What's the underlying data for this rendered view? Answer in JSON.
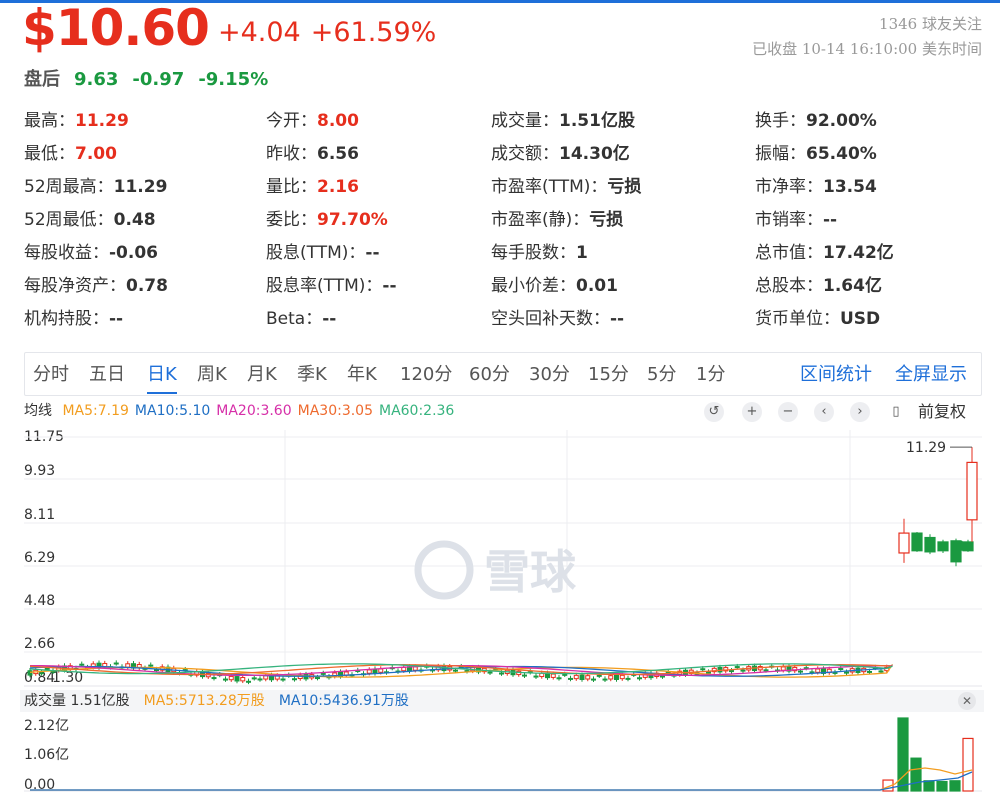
{
  "quote": {
    "price": "$10.60",
    "change": "+4.04",
    "change_pct": "+61.59%",
    "followers": "1346 球友关注",
    "market_status": "已收盘 10-14 16:10:00 美东时间"
  },
  "after_hours": {
    "label": "盘后",
    "price": "9.63",
    "change": "-0.97",
    "change_pct": "-9.15%"
  },
  "stats": [
    {
      "k": "最高：",
      "v": "11.29",
      "red": true
    },
    {
      "k": "今开：",
      "v": "8.00",
      "red": true
    },
    {
      "k": "成交量：",
      "v": "1.51亿股",
      "red": false
    },
    {
      "k": "换手：",
      "v": "92.00%",
      "red": false
    },
    {
      "k": "最低：",
      "v": "7.00",
      "red": true
    },
    {
      "k": "昨收：",
      "v": "6.56",
      "red": false
    },
    {
      "k": "成交额：",
      "v": "14.30亿",
      "red": false
    },
    {
      "k": "振幅：",
      "v": "65.40%",
      "red": false
    },
    {
      "k": "52周最高：",
      "v": "11.29",
      "red": false
    },
    {
      "k": "量比：",
      "v": "2.16",
      "red": true
    },
    {
      "k": "市盈率(TTM)：",
      "v": "亏损",
      "red": false
    },
    {
      "k": "市净率：",
      "v": "13.54",
      "red": false
    },
    {
      "k": "52周最低：",
      "v": "0.48",
      "red": false
    },
    {
      "k": "委比：",
      "v": "97.70%",
      "red": true
    },
    {
      "k": "市盈率(静)：",
      "v": "亏损",
      "red": false
    },
    {
      "k": "市销率：",
      "v": "--",
      "red": false
    },
    {
      "k": "每股收益：",
      "v": "-0.06",
      "red": false
    },
    {
      "k": "股息(TTM)：",
      "v": "--",
      "red": false
    },
    {
      "k": "每手股数：",
      "v": "1",
      "red": false
    },
    {
      "k": "总市值：",
      "v": "17.42亿",
      "red": false
    },
    {
      "k": "每股净资产：",
      "v": "0.78",
      "red": false
    },
    {
      "k": "股息率(TTM)：",
      "v": "--",
      "red": false
    },
    {
      "k": "最小价差：",
      "v": "0.01",
      "red": false
    },
    {
      "k": "总股本：",
      "v": "1.64亿",
      "red": false
    },
    {
      "k": "机构持股：",
      "v": "--",
      "red": false
    },
    {
      "k": "Beta：",
      "v": "--",
      "red": false
    },
    {
      "k": "空头回补天数：",
      "v": "--",
      "red": false
    },
    {
      "k": "货币单位：",
      "v": "USD",
      "red": false
    }
  ],
  "tabs": [
    {
      "label": "分时",
      "active": false
    },
    {
      "label": "五日",
      "active": false
    },
    {
      "label": "日K",
      "active": true
    },
    {
      "label": "周K",
      "active": false
    },
    {
      "label": "月K",
      "active": false
    },
    {
      "label": "季K",
      "active": false
    },
    {
      "label": "年K",
      "active": false
    },
    {
      "label": "120分",
      "active": false
    },
    {
      "label": "60分",
      "active": false
    },
    {
      "label": "30分",
      "active": false
    },
    {
      "label": "15分",
      "active": false
    },
    {
      "label": "5分",
      "active": false
    },
    {
      "label": "1分",
      "active": false
    }
  ],
  "tab_actions": {
    "range_stats": "区间统计",
    "fullscreen": "全屏显示"
  },
  "ma_legend": {
    "title": "均线",
    "items": [
      {
        "label": "MA5:7.19",
        "color": "#f29d1f"
      },
      {
        "label": "MA10:5.10",
        "color": "#1f6fc4"
      },
      {
        "label": "MA20:3.60",
        "color": "#d62fa8"
      },
      {
        "label": "MA30:3.05",
        "color": "#ee6a2e"
      },
      {
        "label": "MA60:2.36",
        "color": "#36b37e"
      }
    ]
  },
  "toolbar": {
    "undo": "↺",
    "zoom_in": "+",
    "zoom_out": "−",
    "prev": "‹",
    "next": "›",
    "settings": "▯",
    "adjust_label": "前复权"
  },
  "watermark": "雪球",
  "chart_data": {
    "type": "candlestick",
    "price_axis": {
      "ticks": [
        "11.75",
        "9.93",
        "8.11",
        "6.29",
        "4.48",
        "2.66",
        "0.84"
      ],
      "low_label": "1.30",
      "ylim": [
        0.84,
        11.75
      ]
    },
    "max_label": "11.29",
    "colors": {
      "up": "#e62e1d",
      "down": "#1a9940"
    },
    "recent_candles": [
      {
        "o": 6.5,
        "h": 8.05,
        "l": 6.05,
        "c": 7.4
      },
      {
        "o": 7.4,
        "h": 7.45,
        "l": 6.55,
        "c": 6.6
      },
      {
        "o": 7.2,
        "h": 7.35,
        "l": 6.45,
        "c": 6.55
      },
      {
        "o": 7.0,
        "h": 7.1,
        "l": 6.5,
        "c": 6.6
      },
      {
        "o": 7.05,
        "h": 7.15,
        "l": 5.9,
        "c": 6.1
      },
      {
        "o": 7.0,
        "h": 7.1,
        "l": 6.55,
        "c": 6.6
      },
      {
        "o": 6.9,
        "h": 7.05,
        "l": 6.6,
        "c": 6.7
      },
      {
        "o": 8.0,
        "h": 11.29,
        "l": 7.0,
        "c": 10.6
      }
    ],
    "volume": {
      "title": "成交量 1.51亿股",
      "ma5": "MA5:5713.28万股",
      "ma10": "MA10:5436.91万股",
      "ma5_color": "#f29d1f",
      "ma10_color": "#1f6fc4",
      "ticks": [
        "2.12亿",
        "1.06亿",
        "0.00"
      ]
    }
  }
}
